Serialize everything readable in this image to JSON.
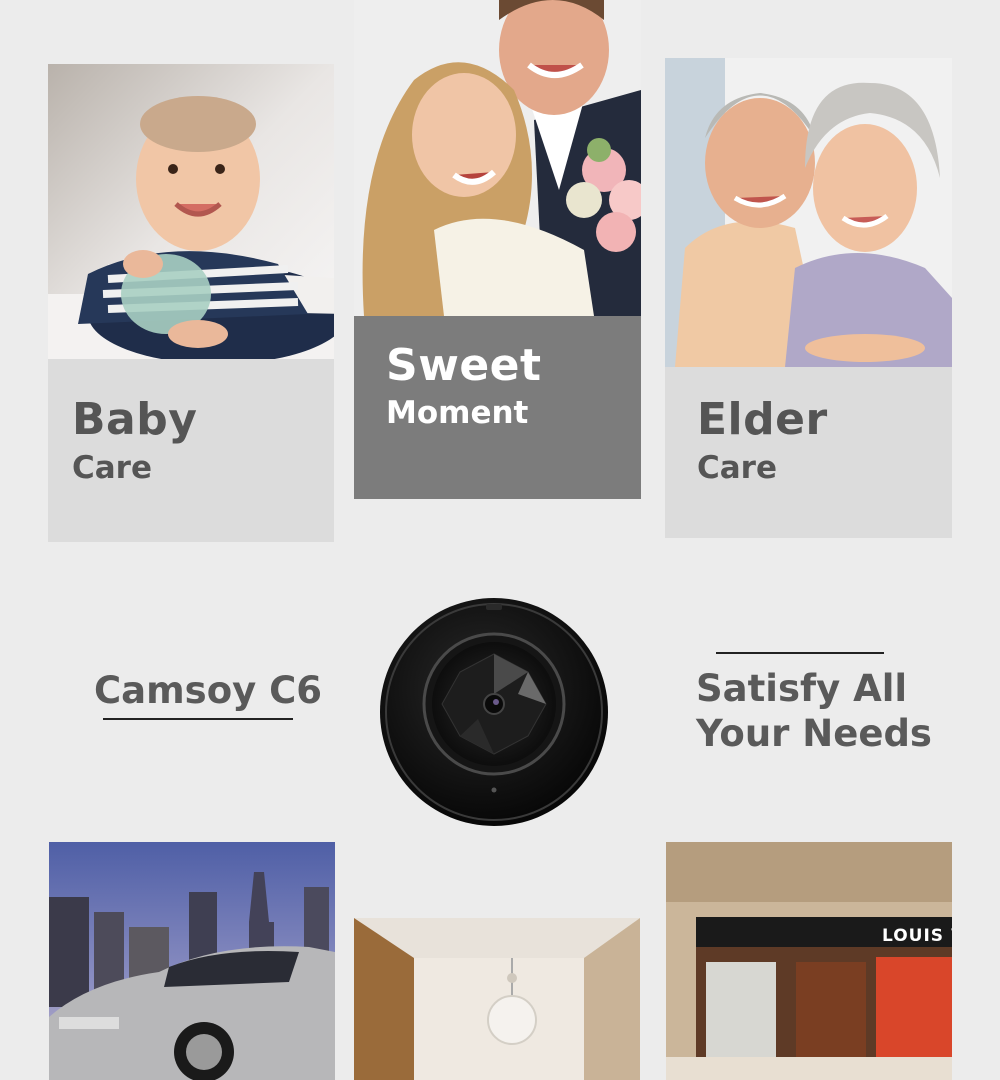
{
  "cards": {
    "baby": {
      "title": "Baby",
      "subtitle": "Care",
      "image": "baby-photo"
    },
    "sweet": {
      "title": "Sweet",
      "subtitle": "Moment",
      "image": "couple-photo"
    },
    "elder": {
      "title": "Elder",
      "subtitle": "Care",
      "image": "elderly-couple-photo"
    }
  },
  "product": {
    "name": "Camsoy C6",
    "image": "mini-camera-icon"
  },
  "tagline": {
    "line1": "Satisfy All",
    "line2": "Your Needs"
  },
  "bottom_images": [
    "car-photo",
    "room-photo",
    "store-photo"
  ],
  "store_sign": "LOUIS V",
  "colors": {
    "background": "#ececec",
    "panel_light": "#dcdcdc",
    "panel_dark": "#7c7c7c",
    "text_dark": "#555555",
    "text_light": "#ffffff"
  }
}
